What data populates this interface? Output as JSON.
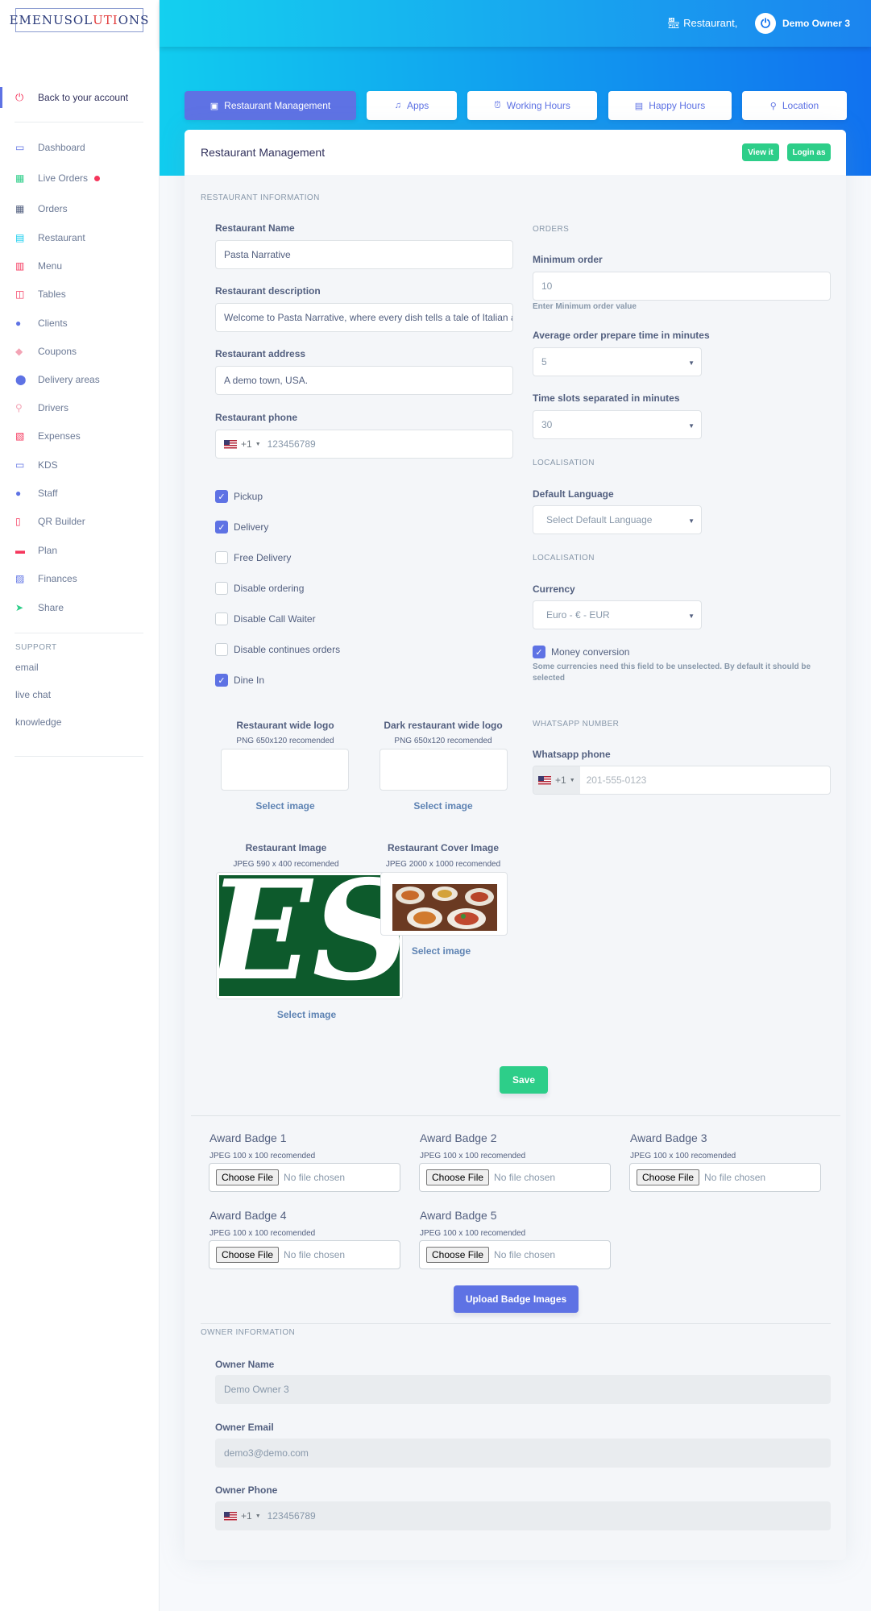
{
  "logo": {
    "pre": "EMENUSOL",
    "hl": "U",
    "mid": "TI",
    "hl2": "O",
    "post": "NS"
  },
  "sidebar": {
    "back": "Back to your account",
    "items": [
      {
        "label": "Dashboard",
        "icon": "monitor-icon",
        "color": "#5e72e4"
      },
      {
        "label": "Live Orders",
        "icon": "basket-icon",
        "color": "#2dce89"
      },
      {
        "label": "Orders",
        "icon": "basket-icon",
        "color": "#525f7f"
      },
      {
        "label": "Restaurant",
        "icon": "shop-icon",
        "color": "#11cdef"
      },
      {
        "label": "Menu",
        "icon": "book-icon",
        "color": "#f5365c"
      },
      {
        "label": "Tables",
        "icon": "tables-icon",
        "color": "#f5365c"
      },
      {
        "label": "Clients",
        "icon": "user-icon",
        "color": "#5e72e4"
      },
      {
        "label": "Coupons",
        "icon": "tag-icon",
        "color": "#f3a4b5"
      },
      {
        "label": "Delivery areas",
        "icon": "pin-icon",
        "color": "#5e72e4"
      },
      {
        "label": "Drivers",
        "icon": "scooter-icon",
        "color": "#f3a4b5"
      },
      {
        "label": "Expenses",
        "icon": "chart-icon",
        "color": "#f5365c"
      },
      {
        "label": "KDS",
        "icon": "monitor-icon",
        "color": "#5e72e4"
      },
      {
        "label": "Staff",
        "icon": "user-icon",
        "color": "#5e72e4"
      },
      {
        "label": "QR Builder",
        "icon": "mobile-icon",
        "color": "#f5365c"
      },
      {
        "label": "Plan",
        "icon": "credit-card-icon",
        "color": "#f5365c"
      },
      {
        "label": "Finances",
        "icon": "finance-icon",
        "color": "#5e72e4"
      },
      {
        "label": "Share",
        "icon": "send-icon",
        "color": "#2dce89"
      }
    ],
    "support_title": "SUPPORT",
    "support_links": [
      "email",
      "live chat",
      "knowledge"
    ]
  },
  "topbar": {
    "restaurant": "Restaurant,",
    "user": "Demo Owner 3"
  },
  "tabs": [
    "Restaurant Management",
    "Apps",
    "Working Hours",
    "Happy Hours",
    "Location"
  ],
  "card": {
    "title": "Restaurant Management",
    "view_it": "View it",
    "login_as": "Login as"
  },
  "restaurant_info": {
    "section": "RESTAURANT INFORMATION",
    "name_label": "Restaurant Name",
    "name_value": "Pasta Narrative",
    "desc_label": "Restaurant description",
    "desc_value": "Welcome to Pasta Narrative, where every dish tells a tale of Italian a",
    "addr_label": "Restaurant address",
    "addr_value": "A demo town, USA.",
    "phone_label": "Restaurant phone",
    "phone_code": "+1",
    "phone_value": "123456789"
  },
  "checkboxes": [
    {
      "label": "Pickup",
      "checked": true
    },
    {
      "label": "Delivery",
      "checked": true
    },
    {
      "label": "Free Delivery",
      "checked": false
    },
    {
      "label": "Disable ordering",
      "checked": false
    },
    {
      "label": "Disable Call Waiter",
      "checked": false
    },
    {
      "label": "Disable continues orders",
      "checked": false
    },
    {
      "label": "Dine In",
      "checked": true
    }
  ],
  "images": {
    "logo_title": "Restaurant wide logo",
    "logo_sub": "PNG 650x120 recomended",
    "dark_title": "Dark restaurant wide logo",
    "dark_sub": "PNG 650x120 recomended",
    "image_title": "Restaurant Image",
    "image_sub": "JPEG 590 x 400 recomended",
    "cover_title": "Restaurant Cover Image",
    "cover_sub": "JPEG 2000 x 1000 recomended",
    "select": "Select image",
    "es_letters": "ES"
  },
  "orders": {
    "section": "ORDERS",
    "min_label": "Minimum order",
    "min_value": "10",
    "min_help": "Enter Minimum order value",
    "prep_label": "Average order prepare time in minutes",
    "prep_value": "5",
    "slots_label": "Time slots separated in minutes",
    "slots_value": "30"
  },
  "localisation": {
    "section": "LOCALISATION",
    "lang_label": "Default Language",
    "lang_value": "Select Default Language",
    "section2": "LOCALISATION",
    "currency_label": "Currency",
    "currency_value": "Euro - € - EUR",
    "money_label": "Money conversion",
    "money_checked": true,
    "money_help": "Some currencies need this field to be unselected. By default it should be selected"
  },
  "whatsapp": {
    "section": "WHATSAPP NUMBER",
    "label": "Whatsapp phone",
    "code": "+1",
    "placeholder": "201-555-0123"
  },
  "save": "Save",
  "badges": {
    "items": [
      "Award Badge 1",
      "Award Badge 2",
      "Award Badge 3",
      "Award Badge 4",
      "Award Badge 5"
    ],
    "sub": "JPEG 100 x 100 recomended",
    "choose": "Choose File",
    "none": "No file chosen",
    "upload": "Upload Badge Images"
  },
  "owner": {
    "section": "OWNER INFORMATION",
    "name_label": "Owner Name",
    "name_value": "Demo Owner 3",
    "email_label": "Owner Email",
    "email_value": "demo3@demo.com",
    "phone_label": "Owner Phone",
    "phone_code": "+1",
    "phone_value": "123456789"
  }
}
